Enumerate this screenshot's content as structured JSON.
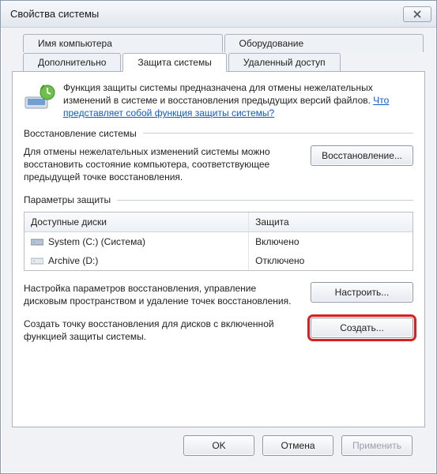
{
  "window": {
    "title": "Свойства системы",
    "close_aria": "Закрыть"
  },
  "tabs": {
    "computer_name": "Имя компьютера",
    "hardware": "Оборудование",
    "advanced": "Дополнительно",
    "protection": "Защита системы",
    "remote": "Удаленный доступ"
  },
  "intro": {
    "text_before_link": "Функция защиты системы предназначена для отмены нежелательных изменений в системе и восстановления предыдущих версий файлов. ",
    "link_text": "Что представляет собой функция защиты системы?"
  },
  "restore": {
    "section_title": "Восстановление системы",
    "description": "Для отмены нежелательных изменений системы можно восстановить состояние компьютера, соответствующее предыдущей точке восстановления.",
    "button": "Восстановление..."
  },
  "protection": {
    "section_title": "Параметры защиты",
    "col_disks": "Доступные диски",
    "col_protection": "Защита",
    "rows": [
      {
        "name": "System (C:) (Система)",
        "status": "Включено"
      },
      {
        "name": "Archive (D:)",
        "status": "Отключено"
      }
    ]
  },
  "configure": {
    "description": "Настройка параметров восстановления, управление дисковым пространством и удаление точек восстановления.",
    "button": "Настроить..."
  },
  "create": {
    "description": "Создать точку восстановления для дисков с включенной функцией защиты системы.",
    "button": "Создать..."
  },
  "footer": {
    "ok": "OK",
    "cancel": "Отмена",
    "apply": "Применить"
  }
}
